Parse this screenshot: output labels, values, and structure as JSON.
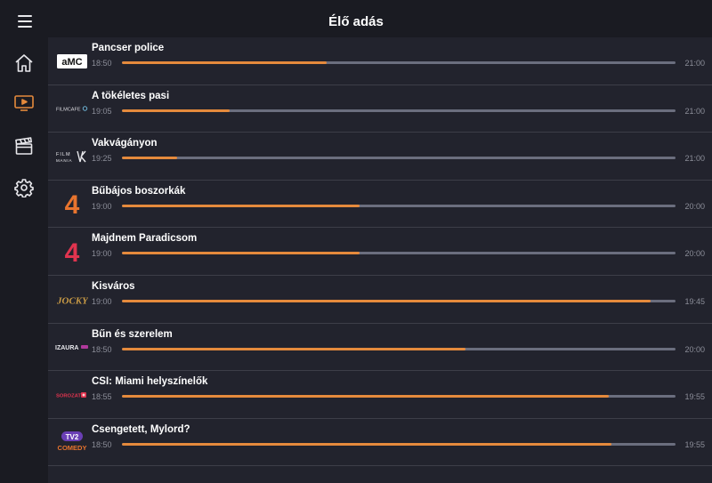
{
  "header": {
    "title": "Élő adás"
  },
  "sidebar": {
    "items": [
      {
        "icon": "home-icon",
        "active": false
      },
      {
        "icon": "live-tv-icon",
        "active": true
      },
      {
        "icon": "movie-clapper-icon",
        "active": false
      },
      {
        "icon": "gear-icon",
        "active": false
      }
    ]
  },
  "colors": {
    "accent": "#e58a3c",
    "track": "#6b6e7e",
    "background": "#22232d",
    "sidebar": "#1a1b22"
  },
  "channels": [
    {
      "logo": "amc-logo",
      "logo_text": "aMC",
      "title": "Pancser police",
      "start": "18:50",
      "end": "21:00",
      "progress": 0.37
    },
    {
      "logo": "filmcafe-logo",
      "logo_text": "FILMCAFE",
      "title": "A tökéletes pasi",
      "start": "19:05",
      "end": "21:00",
      "progress": 0.195
    },
    {
      "logo": "filmmania-logo",
      "logo_text": "FILM MANIA",
      "title": "Vakvágányon",
      "start": "19:25",
      "end": "21:00",
      "progress": 0.1
    },
    {
      "logo": "rtl4-story-logo",
      "logo_text": "4",
      "title": "Bűbájos boszorkák",
      "start": "19:00",
      "end": "20:00",
      "progress": 0.43
    },
    {
      "logo": "tv4-logo",
      "logo_text": "4",
      "title": "Majdnem Paradicsom",
      "start": "19:00",
      "end": "20:00",
      "progress": 0.43
    },
    {
      "logo": "jocky-logo",
      "logo_text": "JOCKY",
      "title": "Kisváros",
      "start": "19:00",
      "end": "19:45",
      "progress": 0.955
    },
    {
      "logo": "izaura-logo",
      "logo_text": "IZAURA",
      "title": "Bűn és szerelem",
      "start": "18:50",
      "end": "20:00",
      "progress": 0.62
    },
    {
      "logo": "sorozat-logo",
      "logo_text": "SOROZAT",
      "title": "CSI: Miami helyszínelők",
      "start": "18:55",
      "end": "19:55",
      "progress": 0.88
    },
    {
      "logo": "tv2-comedy-logo",
      "logo_text": "TV2 COMEDY",
      "title": "Csengetett, Mylord?",
      "start": "18:50",
      "end": "19:55",
      "progress": 0.885
    }
  ]
}
